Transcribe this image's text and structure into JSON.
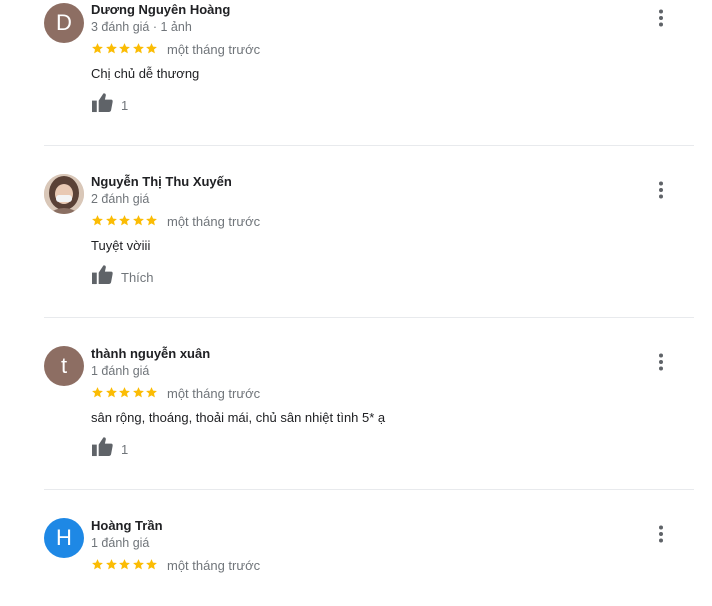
{
  "colors": {
    "star": "#fbbc04",
    "divider": "#e8eaed",
    "meta": "#70757a"
  },
  "reviews": [
    {
      "avatar_letter": "D",
      "avatar_color": "#8d6e63",
      "name": "Dương Nguyên Hoàng",
      "meta": "3 đánh giá · 1 ảnh",
      "rating": 5,
      "time": "một tháng trước",
      "text": "Chị chủ dễ thương",
      "like_label": "1"
    },
    {
      "avatar_letter": "",
      "avatar_color": "#cbb6a6",
      "avatar_photo": true,
      "name": "Nguyễn Thị Thu Xuyến",
      "meta": "2 đánh giá",
      "rating": 5,
      "time": "một tháng trước",
      "text": "Tuyệt vờiii",
      "like_label": "Thích"
    },
    {
      "avatar_letter": "t",
      "avatar_color": "#8d6e63",
      "name": "thành nguyễn xuân",
      "meta": "1 đánh giá",
      "rating": 5,
      "time": "một tháng trước",
      "text": "sân rộng, thoáng, thoải mái, chủ sân nhiệt tình 5* ạ",
      "like_label": "1"
    },
    {
      "avatar_letter": "H",
      "avatar_color": "#1e88e5",
      "name": "Hoàng Trần",
      "meta": "1 đánh giá",
      "rating": 5,
      "time": "một tháng trước"
    }
  ]
}
